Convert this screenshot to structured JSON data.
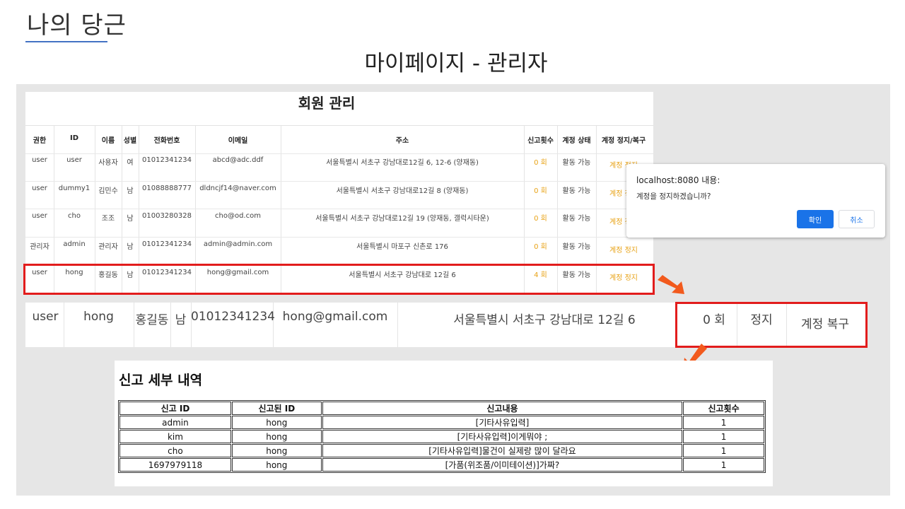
{
  "slide": {
    "title": "나의 당근",
    "subtitle": "마이페이지 - 관리자"
  },
  "member_table": {
    "title": "회원 관리",
    "headers": [
      "권한",
      "ID",
      "이름",
      "성별",
      "전화번호",
      "이메일",
      "주소",
      "신고횟수",
      "계정 상태",
      "계정 정지/복구"
    ],
    "rows": [
      [
        "user",
        "user",
        "사용자",
        "여",
        "01012341234",
        "abcd@adc.ddf",
        "서울특별시 서초구 강남대로12길 6, 12-6 (양재동)",
        "0 회",
        "활동 가능",
        "계정 정지"
      ],
      [
        "user",
        "dummy1",
        "김민수",
        "남",
        "01088888777",
        "dldncjf14@naver.com",
        "서울특별시 서초구 강남대로12길 8 (양재동)",
        "0 회",
        "활동 가능",
        "계정 정지"
      ],
      [
        "user",
        "cho",
        "조조",
        "남",
        "01003280328",
        "cho@od.com",
        "서울특별시 서초구 강남대로12길 19 (양재동, 갤럭시타운)",
        "0 회",
        "활동 가능",
        "계정 정지"
      ],
      [
        "관리자",
        "admin",
        "관리자",
        "남",
        "01012341234",
        "admin@admin.com",
        "서울특별시 마포구 신촌로 176",
        "0 회",
        "활동 가능",
        "계정 정지"
      ],
      [
        "user",
        "hong",
        "홍길동",
        "남",
        "01012341234",
        "hong@gmail.com",
        "서울특별시 서초구 강남대로 12길 6",
        "4 회",
        "활동 가능",
        "계정 정지"
      ]
    ]
  },
  "dialog": {
    "title": "localhost:8080 내용:",
    "message": "계정을 정지하겠습니까?",
    "ok_label": "확인",
    "cancel_label": "취소"
  },
  "zoom_row": {
    "cells": [
      "user",
      "hong",
      "홍길동",
      "남",
      "01012341234",
      "hong@gmail.com",
      "서울특별시 서초구 강남대로 12길 6",
      "0 회",
      "정지",
      "계정 복구"
    ]
  },
  "report": {
    "title": "신고 세부 내역",
    "headers": [
      "신고 ID",
      "신고된 ID",
      "신고내용",
      "신고횟수"
    ],
    "rows": [
      [
        "admin",
        "hong",
        "[기타사유입력]",
        "1"
      ],
      [
        "kim",
        "hong",
        "[기타사유입력]이게뭐야 ;",
        "1"
      ],
      [
        "cho",
        "hong",
        "[기타사유입력]물건이 실제랑 많이 달라요",
        "1"
      ],
      [
        "1697979118",
        "hong",
        "[가품(위조품/이미테이션)]가짜?",
        "1"
      ]
    ]
  },
  "colors": {
    "accent_orange": "#e8a317",
    "highlight_red": "#e21c1c",
    "arrow_orange": "#f25a1d",
    "dialog_blue": "#1a73e8"
  }
}
